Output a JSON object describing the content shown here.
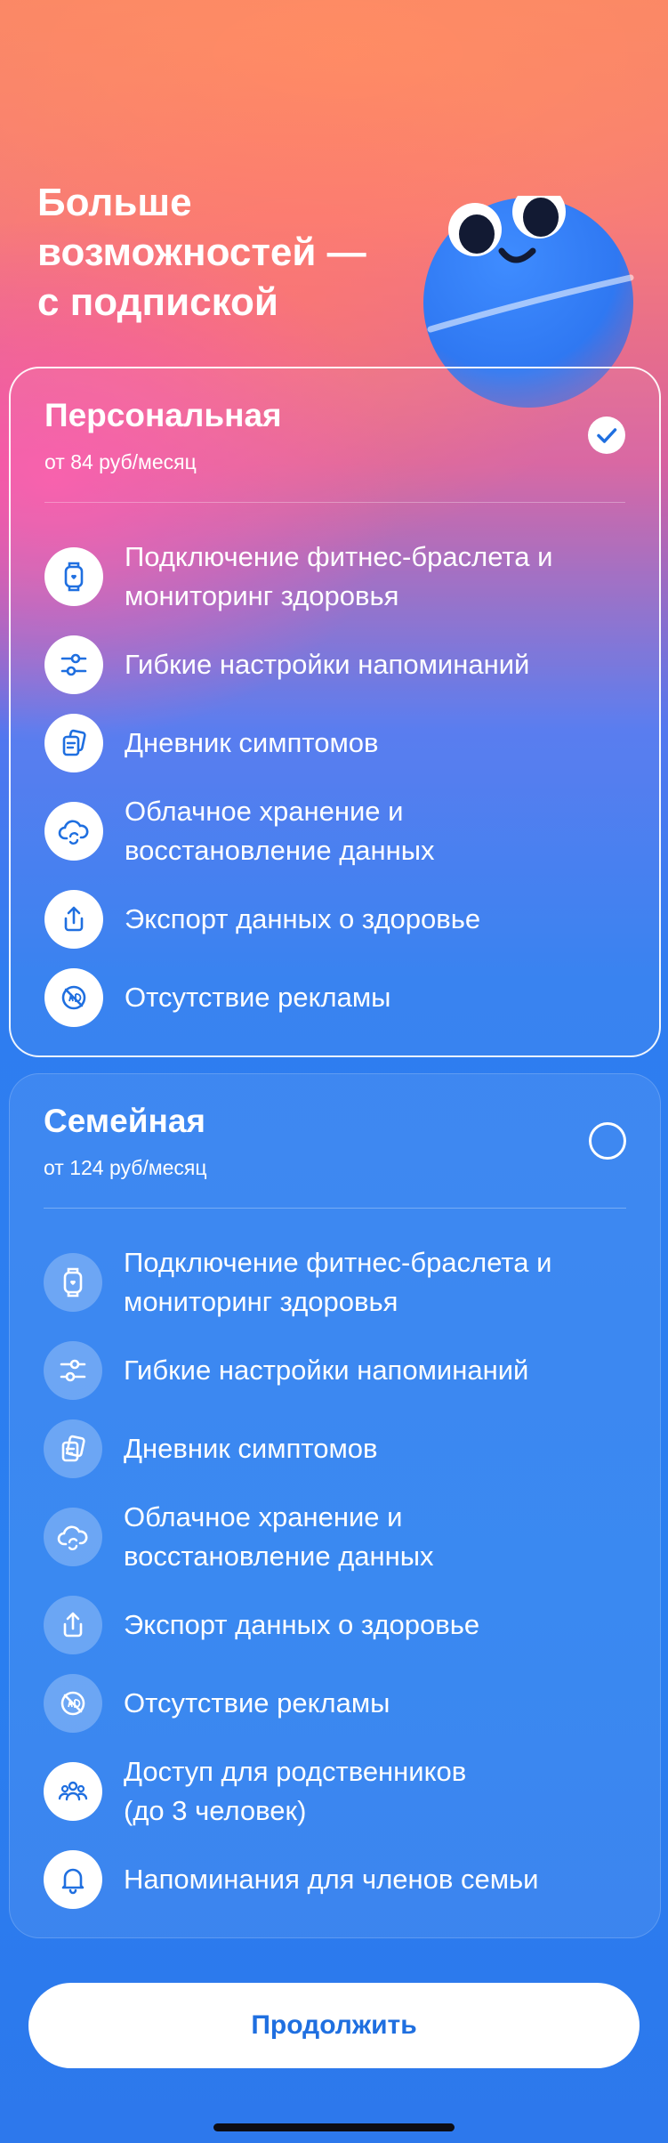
{
  "header": {
    "title_lines": [
      "Больше",
      "возможностей —",
      "с подпиской"
    ]
  },
  "plans": [
    {
      "name": "Персональная",
      "price": "от 84 руб/месяц",
      "selected": true,
      "features": [
        {
          "icon": "watch-icon",
          "label": "Подключение фитнес-браслета и\nмониторинг здоровья"
        },
        {
          "icon": "sliders-icon",
          "label": "Гибкие настройки напоминаний"
        },
        {
          "icon": "notes-icon",
          "label": "Дневник симптомов"
        },
        {
          "icon": "cloud-sync-icon",
          "label": "Облачное хранение и\nвосстановление данных"
        },
        {
          "icon": "share-icon",
          "label": "Экспорт данных о здоровье"
        },
        {
          "icon": "no-ads-icon",
          "label": "Отсутствие рекламы"
        }
      ]
    },
    {
      "name": "Семейная",
      "price": "от 124 руб/месяц",
      "selected": false,
      "features": [
        {
          "icon": "watch-icon",
          "label": "Подключение фитнес-браслета и\nмониторинг здоровья"
        },
        {
          "icon": "sliders-icon",
          "label": "Гибкие настройки напоминаний"
        },
        {
          "icon": "notes-icon",
          "label": "Дневник симптомов"
        },
        {
          "icon": "cloud-sync-icon",
          "label": "Облачное хранение и\nвосстановление данных"
        },
        {
          "icon": "share-icon",
          "label": "Экспорт данных о здоровье"
        },
        {
          "icon": "no-ads-icon",
          "label": "Отсутствие рекламы"
        },
        {
          "icon": "family-icon",
          "label": "Доступ для родственников\n(до 3 человек)"
        },
        {
          "icon": "bell-icon",
          "label": "Напоминания для членов семьи"
        }
      ]
    }
  ],
  "continue_button": {
    "label": "Продолжить"
  },
  "colors": {
    "accent": "#1f6fe0",
    "card_border": "#ffffff",
    "background_top": "#f98766",
    "background_bottom": "#2a7ff0"
  }
}
